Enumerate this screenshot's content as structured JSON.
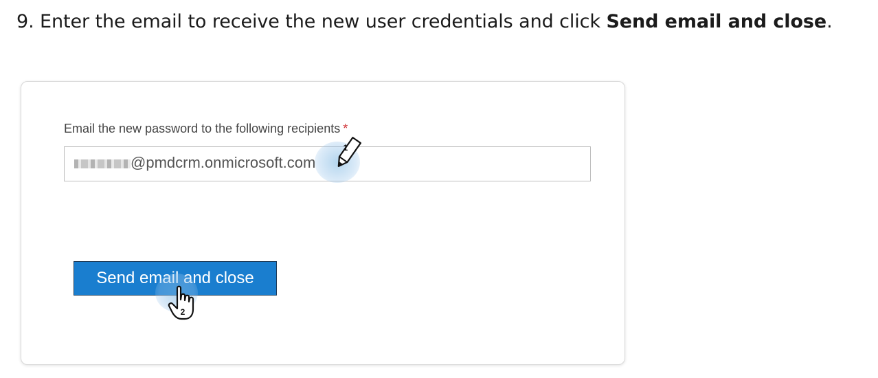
{
  "instruction": {
    "prefix": "9. Enter the email to receive the new user credentials and click ",
    "bold": "Send email and close",
    "suffix": "."
  },
  "dialog": {
    "field_label": "Email the new password to the following recipients",
    "required_mark": "*",
    "email_value": "@pmdcrm.onmicrosoft.com",
    "send_button_label": "Send email and close"
  },
  "markers": {
    "step1": "1",
    "step2": "2"
  },
  "colors": {
    "button_bg": "#1a7ecf",
    "required": "#d13438"
  },
  "icons": {
    "step1": "pencil-cursor-icon",
    "step2": "hand-pointer-icon"
  }
}
